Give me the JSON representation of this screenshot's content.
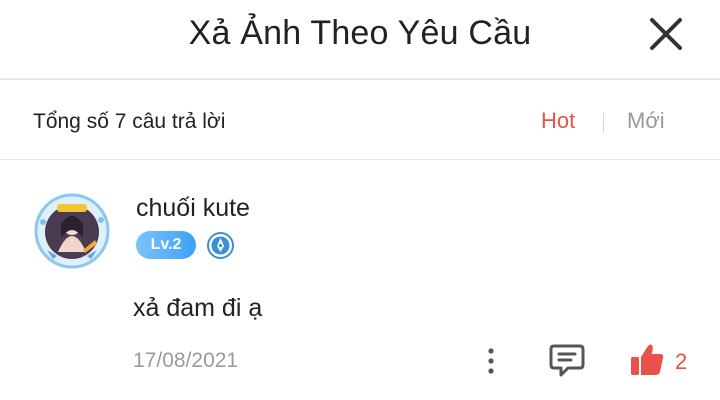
{
  "header": {
    "title": "Xả Ảnh Theo Yêu Cầu",
    "close_icon": "close-icon"
  },
  "summary": {
    "total_answers": "Tổng số 7 câu trả lời"
  },
  "sort": {
    "options": [
      "Hot",
      "Mới"
    ],
    "selected": "Hot"
  },
  "answer": {
    "username": "chuối kute",
    "avatar_icon": "avatar",
    "level": "Lv.2",
    "badge_icon": "pen-badge-icon",
    "text": "xả đam đi ạ",
    "date": "17/08/2021",
    "likes": "2",
    "icons": [
      "more-vertical-icon",
      "comment-icon",
      "thumbs-up-icon"
    ]
  },
  "colors": {
    "accent_red": "#e8524a",
    "muted_gray": "#9a9a9a",
    "level_blue": "#3ea0f6",
    "divider": "#e6e6e6"
  }
}
